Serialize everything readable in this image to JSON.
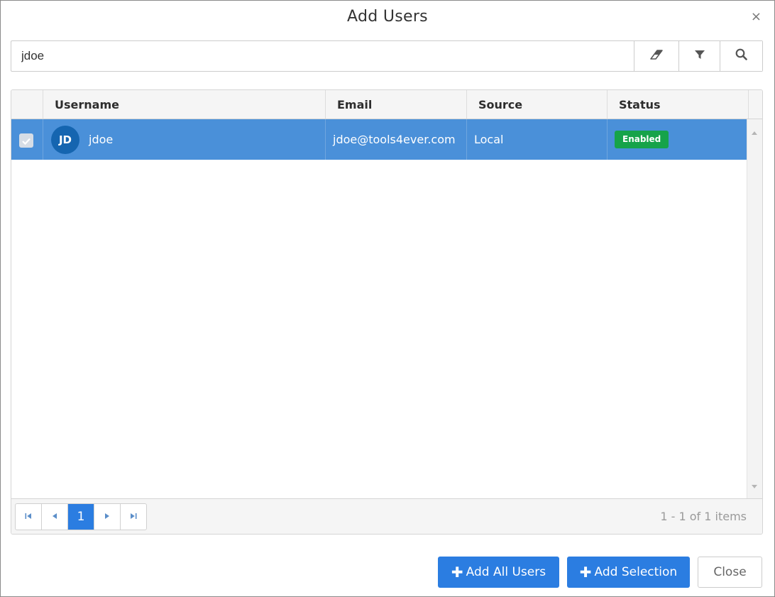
{
  "dialog": {
    "title": "Add Users",
    "close_icon": "close-icon",
    "close_glyph": "×"
  },
  "search": {
    "value": "jdoe",
    "placeholder": "",
    "buttons": [
      "eraser-icon",
      "filter-icon",
      "search-icon"
    ]
  },
  "grid": {
    "columns": [
      "Username",
      "Email",
      "Source",
      "Status"
    ],
    "rows": [
      {
        "selected": true,
        "initials": "JD",
        "username": "jdoe",
        "email": "jdoe@tools4ever.com",
        "source": "Local",
        "status": "Enabled"
      }
    ]
  },
  "pager": {
    "current_page": "1",
    "info": "1 - 1 of 1 items",
    "icons": [
      "first-page-icon",
      "prev-page-icon",
      "next-page-icon",
      "last-page-icon"
    ]
  },
  "footer": {
    "plus_glyph": "✚",
    "add_all_label": "Add All Users",
    "add_selection_label": "Add Selection",
    "close_label": "Close"
  },
  "colors": {
    "primary": "#2b7de1",
    "selected_row": "#4a90d9",
    "avatar": "#1565b0",
    "enabled_badge": "#16a34a"
  }
}
